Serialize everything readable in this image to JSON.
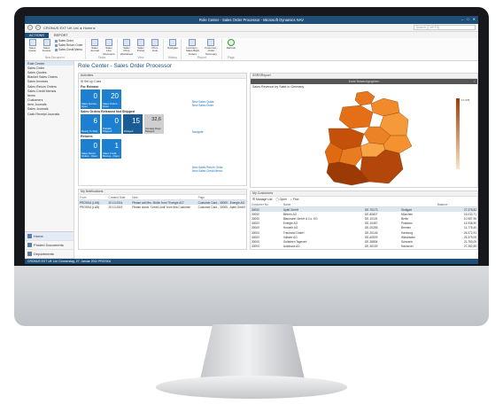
{
  "window": {
    "title": "Role Center - Sales Order Processor - Microsoft Dynamics NAV",
    "controls": [
      "–",
      "□",
      "✕"
    ]
  },
  "navigation": {
    "breadcrumb": "CRONUS EXT UK Ltd. ▸ Home ▸",
    "search_placeholder": "Search (Ctrl+F3)"
  },
  "ribbon": {
    "tabs": [
      "ACTIONS",
      "REPORT"
    ],
    "groups": [
      {
        "name": "New Document",
        "items": [
          "Sales Quote",
          "Sales Invoice"
        ],
        "small": [
          "Sales Order",
          "Sales Return Order",
          "Sales Credit Memo"
        ]
      },
      {
        "name": "Tasks",
        "items": [
          "Sales Journal",
          "Sales Line Discounts"
        ]
      },
      {
        "name": "View",
        "items": [
          "Sales Price Worksheet",
          "Sales Prices",
          "Price Lists"
        ]
      },
      {
        "name": "History",
        "items": [
          "Navigate"
        ]
      },
      {
        "name": "Report",
        "items": [
          "Inventory - Sales Back Orders",
          "Customer - Order Summary"
        ]
      },
      {
        "name": "Page",
        "items": [
          "Refresh"
        ]
      }
    ]
  },
  "leftnav": {
    "items": [
      "Role Center",
      "Sales Order",
      "Sales Quotes",
      "Blanket Sales Orders",
      "Sales Invoices",
      "Sales Return Orders",
      "Sales Credit Memos",
      "Items",
      "Customers",
      "Item Journals",
      "Sales Journals",
      "Cash Receipt Journals"
    ],
    "bottom": [
      "Home",
      "Posted Documents",
      "Departments"
    ]
  },
  "page_title": "Role Center - Sales Order Processor",
  "activities": {
    "header": "Activities",
    "setup": "Set Up Cues",
    "for_release": {
      "title": "For Release",
      "cues": [
        {
          "value": "0",
          "caption": "Sales Quotes - Open"
        },
        {
          "value": "20",
          "caption": "Sales Orders - Open"
        }
      ],
      "links": [
        "New Sales Quote",
        "New Sales Order"
      ]
    },
    "released": {
      "title": "Sales Orders Released Not Shipped",
      "cues": [
        {
          "value": "6",
          "caption": "Ready To Ship"
        },
        {
          "value": "0",
          "caption": "Partially Shipped"
        },
        {
          "value": "15",
          "caption": "Delayed"
        },
        {
          "value": "32,6",
          "caption": "Average Days Delayed"
        }
      ],
      "links": [
        "Navigate"
      ]
    },
    "returns": {
      "title": "Returns",
      "cues": [
        {
          "value": "0",
          "caption": "Sales Return Orders - Open"
        },
        {
          "value": "1",
          "caption": "Sales Credit Memos - Open"
        }
      ],
      "links": [
        "New Sales Return Order",
        "New Sales Credit Memo"
      ]
    }
  },
  "notifications": {
    "header": "My Notifications",
    "columns": [
      "From",
      "Created Date",
      "Note",
      "Page"
    ],
    "rows": [
      [
        "PROSKA (LAN)",
        "20.10.2014",
        "Please call Mrs. Müller from \"Energie AG\"",
        "Customer Card - 30009 - Energie AG"
      ],
      [
        "PROSKA (LAN)",
        "20.10.2014",
        "Please check \"Credit Limit\" from this Customer",
        "Customer Card - 30005 - Apfel GmbH"
      ]
    ]
  },
  "map": {
    "header": "SSRSReport",
    "toolbar_title": "Karte Bekanntgegeben",
    "title": "Sales Revenue by State in Germany",
    "legend_max": "17.378"
  },
  "customers": {
    "header": "My Customers",
    "tools": [
      "Manage List",
      "Open",
      "Find"
    ],
    "columns": [
      "Customer No.",
      "Name",
      "",
      "",
      "Balance"
    ],
    "rows": [
      [
        "30000",
        "Apfel GmbH",
        "DE-70173",
        "Stuttgart",
        "27.275,82"
      ],
      [
        "30000",
        "Binnen AG",
        "DE-80807",
        "München",
        "15.033,71"
      ],
      [
        "30000",
        "Blaumann GmbH & Co. KG",
        "DE-10115",
        "Berlin",
        "10.987,96"
      ],
      [
        "30000",
        "Energie AG",
        "DE-10487",
        "Potsdam",
        "14.938,90"
      ],
      [
        "30000",
        "Horvath AG",
        "DE-20255",
        "Bremen",
        "11.778,40"
      ],
      [
        "30000",
        "Treuhand GmbH",
        "DE-20148",
        "Hamburg",
        "24.072,91"
      ],
      [
        "30000",
        "Voltaire AG",
        "DE-60539",
        "Wiesbaden",
        "25.379,09"
      ],
      [
        "30000",
        "Goltsteen Tageverl",
        "DE-38854",
        "Schwerin",
        "21.783,05"
      ],
      [
        "30000",
        "Autohaus AG",
        "DE-30159",
        "Hannover",
        "27.282,89"
      ],
      [
        "30000",
        "Lyon GmbH",
        "DE-36093",
        "Düsseldorf",
        "22.354,15"
      ]
    ]
  },
  "status": {
    "text": "CRONUS EXT UK Ltd.   Donnerstag, 27. Januar 2011   PROSKA"
  },
  "colors": {
    "accent": "#1f4e79",
    "tile": "#1d7fd0",
    "map_low": "#f4a24a",
    "map_high": "#a63a00"
  }
}
